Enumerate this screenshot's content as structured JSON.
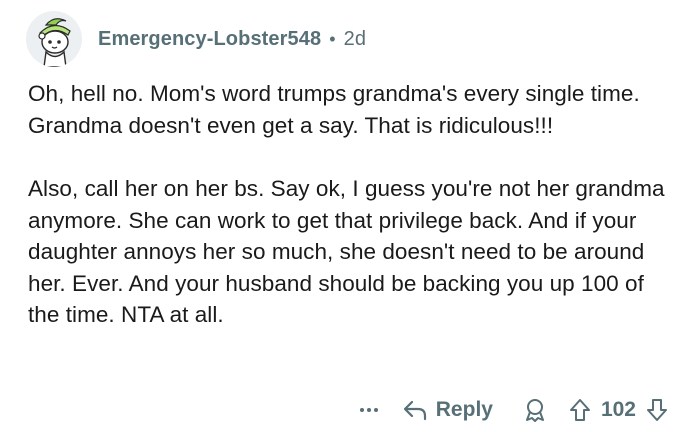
{
  "comment": {
    "author": {
      "username": "Emergency-Lobster548",
      "avatar_icon": "snoo-avatar-icon"
    },
    "separator": "•",
    "age": "2d",
    "paragraphs": [
      "Oh, hell no. Mom's word trumps grandma's every single time. Grandma doesn't even get a say. That is ridiculous!!!",
      "Also, call her on her bs. Say ok, I guess you're not her grandma anymore. She can work to get that privilege back. And if your daughter annoys her so much, she doesn't need to be around her. Ever. And your husband should be backing you up 100 of the time. NTA at all."
    ],
    "actions": {
      "overflow_icon": "more-options-icon",
      "reply_icon": "reply-arrow-icon",
      "reply_label": "Reply",
      "award_icon": "award-icon",
      "upvote_icon": "upvote-arrow-icon",
      "score": "102",
      "downvote_icon": "downvote-arrow-icon"
    }
  },
  "colors": {
    "text": "#1a1a1b",
    "meta": "#576f76",
    "avatar_bg": "#edf0f2",
    "avatar_accent": "#8fd14f"
  }
}
